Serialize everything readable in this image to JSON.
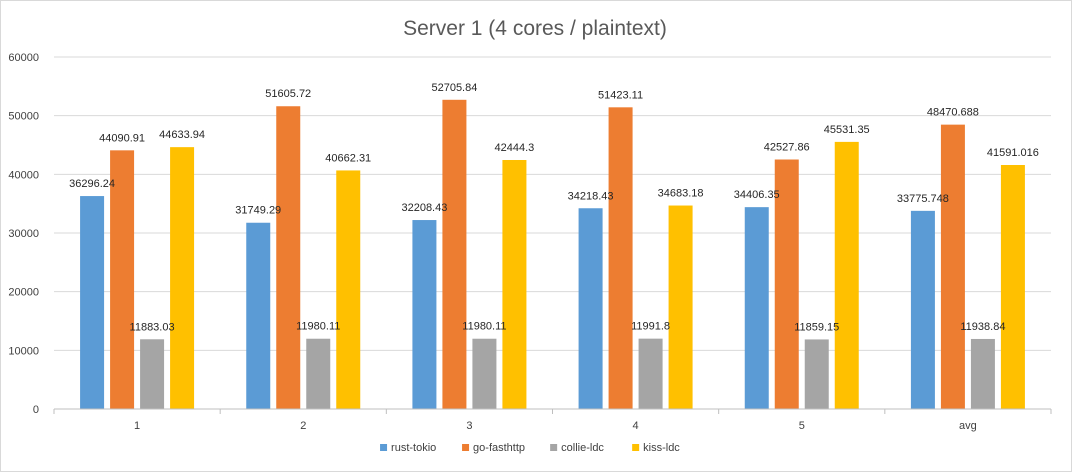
{
  "chart_data": {
    "type": "bar",
    "title": "Server 1 (4 cores / plaintext)",
    "categories": [
      "1",
      "2",
      "3",
      "4",
      "5",
      "avg"
    ],
    "ylim": [
      0,
      60000
    ],
    "yticks": [
      0,
      10000,
      20000,
      30000,
      40000,
      50000,
      60000
    ],
    "grid": true,
    "legend": "bottom",
    "series": [
      {
        "name": "rust-tokio",
        "color": "#5b9bd5",
        "values": [
          36296.24,
          31749.29,
          32208.43,
          34218.43,
          34406.35,
          33775.748
        ],
        "labels": [
          "36296.24",
          "31749.29",
          "32208.43",
          "34218.43",
          "34406.35",
          "33775.748"
        ]
      },
      {
        "name": "go-fasthttp",
        "color": "#ed7d31",
        "values": [
          44090.91,
          51605.72,
          52705.84,
          51423.11,
          42527.86,
          48470.688
        ],
        "labels": [
          "44090.91",
          "51605.72",
          "52705.84",
          "51423.11",
          "42527.86",
          "48470.688"
        ]
      },
      {
        "name": "collie-ldc",
        "color": "#a5a5a5",
        "values": [
          11883.03,
          11980.11,
          11980.11,
          11991.8,
          11859.15,
          11938.84
        ],
        "labels": [
          "11883.03",
          "11980.11",
          "11980.11",
          "11991.8",
          "11859.15",
          "11938.84"
        ]
      },
      {
        "name": "kiss-ldc",
        "color": "#ffc000",
        "values": [
          44633.94,
          40662.31,
          42444.3,
          34683.18,
          45531.35,
          41591.016
        ],
        "labels": [
          "44633.94",
          "40662.31",
          "42444.3",
          "34683.18",
          "45531.35",
          "41591.016"
        ]
      }
    ]
  }
}
